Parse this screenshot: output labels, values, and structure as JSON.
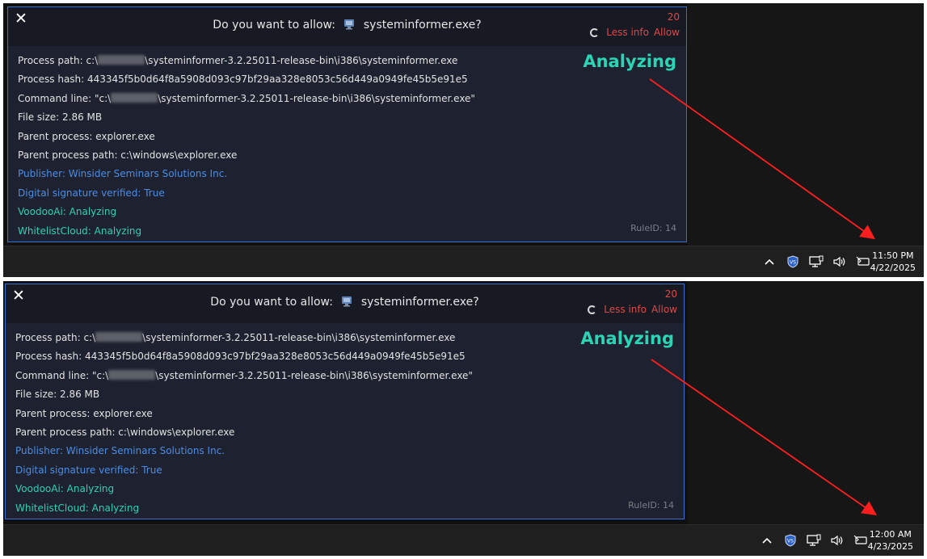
{
  "popup": {
    "close_glyph": "✕",
    "title_prefix": "Do you want to allow:",
    "exe_name": "systeminformer.exe?",
    "counter": "20",
    "less_info": "Less info",
    "allow": "Allow",
    "status": "Analyzing",
    "rule_id": "RuleID: 14",
    "process_path_prefix": "Process path: c:\\",
    "process_path_suffix": "\\systeminformer-3.2.25011-release-bin\\i386\\systeminformer.exe",
    "process_hash": "Process hash: 443345f5b0d64f8a5908d093c97bf29aa328e8053c56d449a0949fe45b5e91e5",
    "command_line_prefix": "Command line: \"c:\\",
    "command_line_suffix": "\\systeminformer-3.2.25011-release-bin\\i386\\systeminformer.exe\"",
    "file_size": "File size: 2.86 MB",
    "parent_process": "Parent process: explorer.exe",
    "parent_process_path": "Parent process path: c:\\windows\\explorer.exe",
    "publisher": "Publisher: Winsider Seminars  Solutions Inc.",
    "signature": "Digital signature verified: True",
    "voodooai": "VoodooAi: Analyzing",
    "whitelistcloud": "WhitelistCloud: Analyzing"
  },
  "taskbar": {
    "icons": [
      "chevron-up-icon",
      "vpn-shield-icon",
      "network-icon",
      "volume-icon",
      "battery-icon"
    ]
  },
  "clocks": [
    {
      "time": "11:50 PM",
      "date": "4/22/2025"
    },
    {
      "time": "12:00 AM",
      "date": "4/23/2025"
    }
  ],
  "colors": {
    "accent_red": "#e04747",
    "border_blue": "#3b6fd1",
    "teal": "#2bd4b4",
    "link_blue": "#4a8de6",
    "arrow": "#ff1e1e"
  }
}
